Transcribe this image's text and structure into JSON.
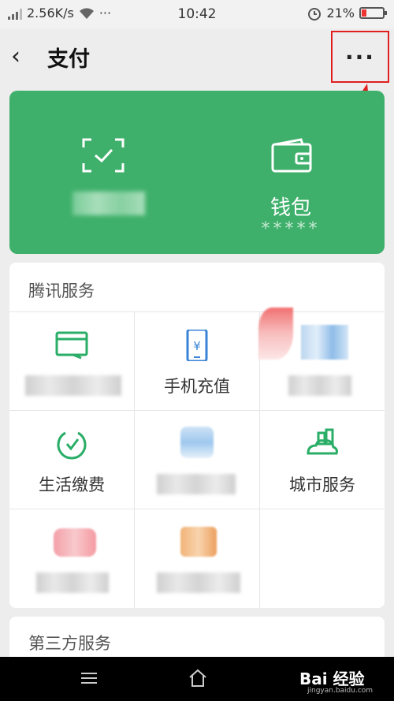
{
  "status_bar": {
    "network_speed": "2.56K/s",
    "dots": "···",
    "time": "10:42",
    "battery": "21%"
  },
  "header": {
    "back_glyph": "‹",
    "title": "支付",
    "more_glyph": "···"
  },
  "card": {
    "wallet_label": "钱包",
    "wallet_balance_masked": "*****",
    "scan_icon": "scan-check-icon",
    "wallet_icon": "wallet-icon"
  },
  "tencent_services": {
    "title": "腾讯服务",
    "items": [
      {
        "label": "",
        "icon": "card-icon"
      },
      {
        "label": "手机充值",
        "icon": "phone-topup-icon"
      },
      {
        "label": "",
        "icon": "blurred-icon"
      },
      {
        "label": "生活缴费",
        "icon": "life-payment-icon"
      },
      {
        "label": "",
        "icon": "blurred-icon"
      },
      {
        "label": "城市服务",
        "icon": "city-service-icon"
      },
      {
        "label": "",
        "icon": "blurred-icon"
      },
      {
        "label": "",
        "icon": "blurred-icon"
      }
    ]
  },
  "third_party": {
    "title": "第三方服务"
  },
  "watermark": {
    "text": "Bai 经验",
    "sub": "jingyan.baidu.com"
  },
  "colors": {
    "card_green": "#3fb06b",
    "icon_green": "#2aae67",
    "icon_blue": "#3a84d8",
    "annotation_red": "#e02020"
  }
}
